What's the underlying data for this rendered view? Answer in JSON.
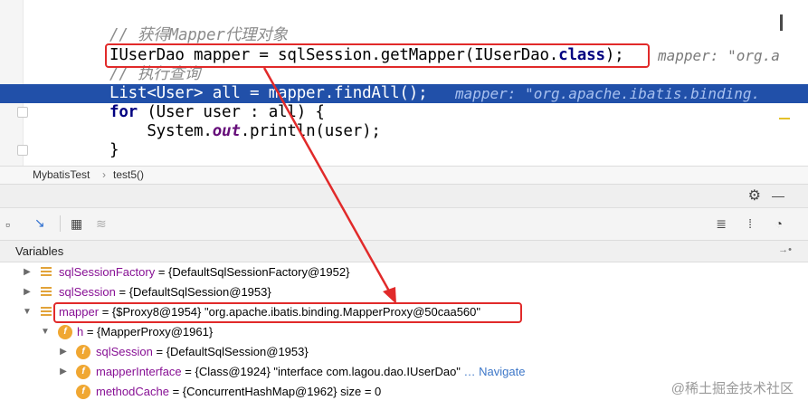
{
  "editor": {
    "line1_comment": "// 获得Mapper代理对象",
    "line2": {
      "pre": "IUserDao mapper = sqlSession.getMapper(IUserDao.",
      "kw": "class",
      "post": ");",
      "hint": "mapper: \"org.a"
    },
    "line3_comment": "// 执行查询",
    "line4": {
      "code": "List<User> all = mapper.findAll();",
      "hint": "mapper: \"org.apache.ibatis.binding."
    },
    "line5": {
      "kw": "for",
      "rest": " (User user : all) {"
    },
    "line6": {
      "pre": "    System.",
      "field": "out",
      "post": ".println(user);"
    },
    "line7": "}"
  },
  "breadcrumb": {
    "class_name": "MybatisTest",
    "separator": "›",
    "method": "test5()"
  },
  "toolbar": {
    "gear_glyph": "⚙",
    "minimize_glyph": "—",
    "icons": [
      "▫",
      "↘",
      "▦",
      "≋"
    ],
    "right_icons": [
      "≣",
      "⁞",
      "◔"
    ]
  },
  "variables": {
    "title": "Variables",
    "pin_glyph": "→•",
    "rows": [
      {
        "name": "sqlSessionFactory",
        "value": " = {DefaultSqlSessionFactory@1952}"
      },
      {
        "name": "sqlSession",
        "value": " = {DefaultSqlSession@1953}"
      },
      {
        "name": "mapper",
        "value": " = {$Proxy8@1954} ",
        "str": "\"org.apache.ibatis.binding.MapperProxy@50caa560\""
      },
      {
        "name": "h",
        "value": " = {MapperProxy@1961}"
      },
      {
        "name": "sqlSession",
        "value": " = {DefaultSqlSession@1953}"
      },
      {
        "name": "mapperInterface",
        "value": " = {Class@1924} ",
        "str": "\"interface com.lagou.dao.IUserDao\"",
        "link": " … Navigate"
      },
      {
        "name": "methodCache",
        "value": " = {ConcurrentHashMap@1962}  size = 0"
      }
    ]
  },
  "watermark": "@稀土掘金技术社区",
  "colors": {
    "accent_red": "#e12a2a",
    "execution_line": "#2150a9",
    "field_icon": "#f0a732"
  }
}
